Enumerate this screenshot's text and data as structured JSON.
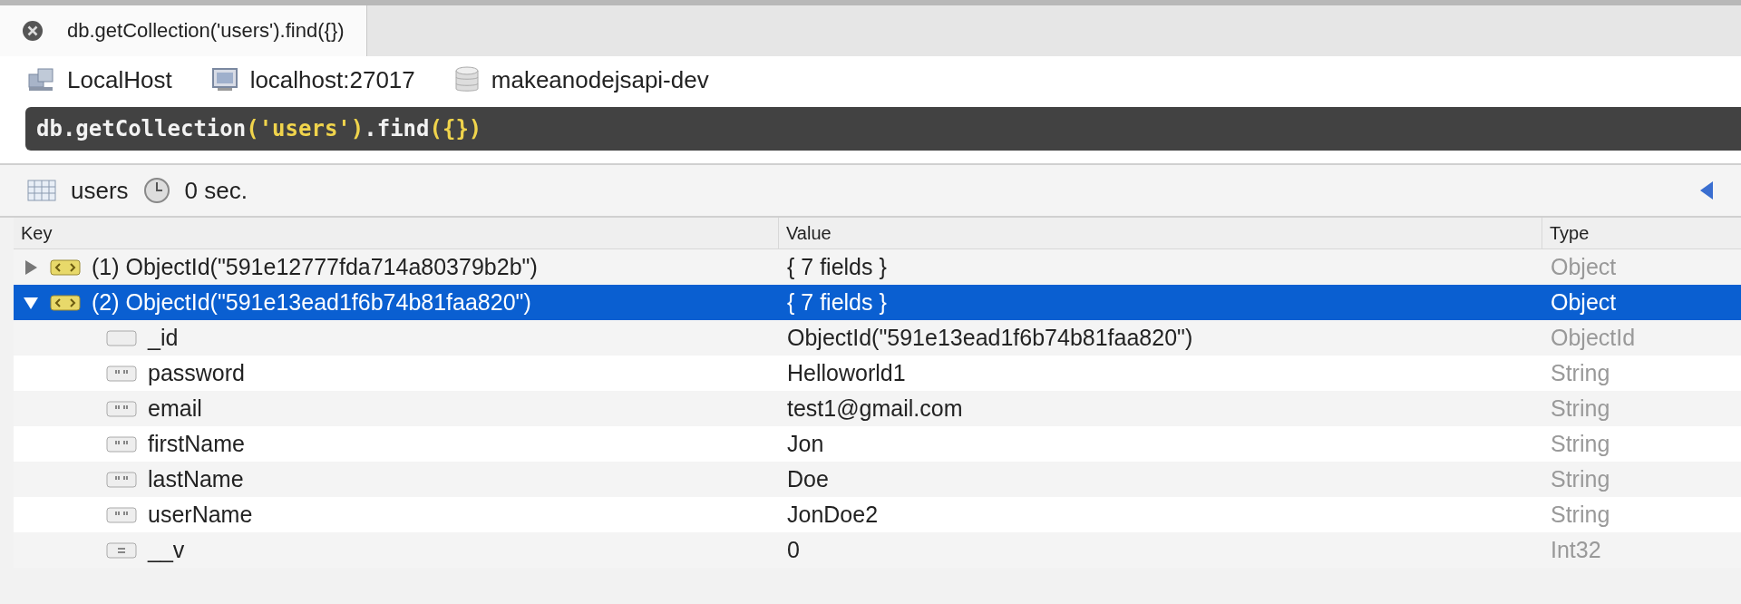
{
  "tabs": [
    {
      "label": "db.getCollection('users').find({})",
      "selected": true
    }
  ],
  "connection": {
    "server": "LocalHost",
    "address": "localhost:27017",
    "database": "makeanodejsapi-dev"
  },
  "query": [
    {
      "text": "db.getCollection",
      "kind": "plain"
    },
    {
      "text": "('users')",
      "kind": "literal"
    },
    {
      "text": ".find",
      "kind": "plain"
    },
    {
      "text": "({})",
      "kind": "literal"
    }
  ],
  "result": {
    "collection": "users",
    "time": "0 sec."
  },
  "table": {
    "columns": [
      "Key",
      "Value",
      "Type"
    ],
    "rows": [
      {
        "key": "(1) ObjectId(\"591e12777fda714a80379b2b\")",
        "value": "{ 7 fields }",
        "type": "Object",
        "kind": "document",
        "expanded": false,
        "selected": false
      },
      {
        "key": "(2) ObjectId(\"591e13ead1f6b74b81faa820\")",
        "value": "{ 7 fields }",
        "type": "Object",
        "kind": "document",
        "expanded": true,
        "selected": true,
        "children": [
          {
            "key": "_id",
            "value": "ObjectId(\"591e13ead1f6b74b81faa820\")",
            "type": "ObjectId",
            "kind": "objectid",
            "selected": false
          },
          {
            "key": "password",
            "value": "Helloworld1",
            "type": "String",
            "kind": "string",
            "selected": false
          },
          {
            "key": "email",
            "value": "test1@gmail.com",
            "type": "String",
            "kind": "string",
            "selected": false
          },
          {
            "key": "firstName",
            "value": "Jon",
            "type": "String",
            "kind": "string",
            "selected": false
          },
          {
            "key": "lastName",
            "value": "Doe",
            "type": "String",
            "kind": "string",
            "selected": false
          },
          {
            "key": "userName",
            "value": "JonDoe2",
            "type": "String",
            "kind": "string",
            "selected": false
          },
          {
            "key": "__v",
            "value": "0",
            "type": "Int32",
            "kind": "number",
            "selected": false
          }
        ]
      }
    ]
  }
}
